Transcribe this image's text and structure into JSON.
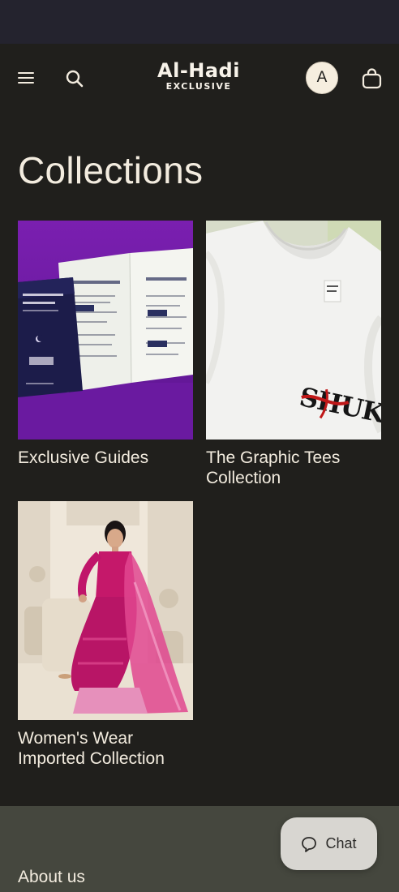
{
  "header": {
    "logo_main": "Al-Hadi",
    "logo_sub": "EXCLUSIVE",
    "avatar_initial": "A"
  },
  "main": {
    "title": "Collections",
    "collections": [
      {
        "title": "Exclusive Guides"
      },
      {
        "title": "The Graphic Tees Collection"
      },
      {
        "title": "Women's Wear Imported Collection"
      }
    ]
  },
  "footer": {
    "about_label": "About us"
  },
  "chat": {
    "label": "Chat"
  },
  "colors": {
    "background": "#201f1c",
    "statusbar": "#24232e",
    "footer": "#45473e",
    "text": "#f3ecdf",
    "chat_button": "#d8d6d1"
  },
  "icons": [
    "menu-icon",
    "search-icon",
    "cart-icon",
    "chat-bubble-icon"
  ]
}
